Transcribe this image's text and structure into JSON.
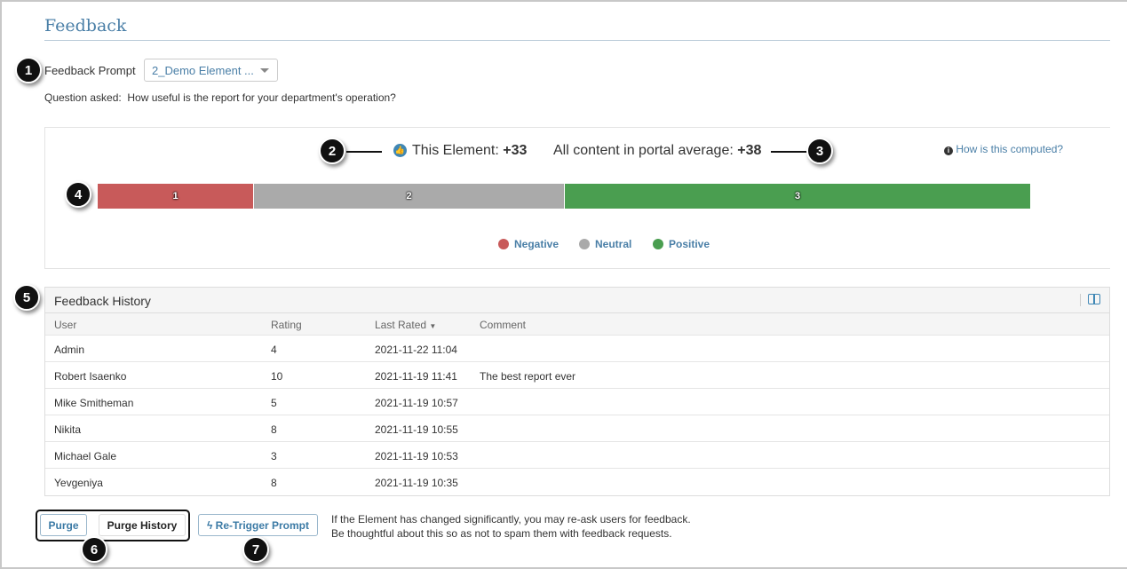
{
  "page": {
    "title": "Feedback"
  },
  "prompt": {
    "label": "Feedback Prompt",
    "selected": "2_Demo Element ...",
    "question_label": "Question asked:",
    "question": "How useful is the report for your department's operation?"
  },
  "summary": {
    "this_label": "This Element:",
    "this_value": "+33",
    "avg_label": "All content in portal average:",
    "avg_value": "+38",
    "help_link": "How is this computed?"
  },
  "chart_data": {
    "type": "bar",
    "stacked": true,
    "categories": [
      "Negative",
      "Neutral",
      "Positive"
    ],
    "values": [
      1,
      2,
      3
    ],
    "colors": [
      "#c85a5a",
      "#aaaaaa",
      "#4a9e50"
    ],
    "legend": [
      "Negative",
      "Neutral",
      "Positive"
    ],
    "legend_placement": "bottom"
  },
  "history": {
    "title": "Feedback History",
    "columns": [
      "User",
      "Rating",
      "Last Rated",
      "Comment"
    ],
    "rows": [
      {
        "user": "Admin",
        "rating": "4",
        "date": "2021-11-22 11:04",
        "comment": ""
      },
      {
        "user": "Robert Isaenko",
        "rating": "10",
        "date": "2021-11-19 11:41",
        "comment": "The best report ever"
      },
      {
        "user": "Mike Smitheman",
        "rating": "5",
        "date": "2021-11-19 10:57",
        "comment": ""
      },
      {
        "user": "Nikita",
        "rating": "8",
        "date": "2021-11-19 10:55",
        "comment": ""
      },
      {
        "user": "Michael Gale",
        "rating": "3",
        "date": "2021-11-19 10:53",
        "comment": ""
      },
      {
        "user": "Yevgeniya",
        "rating": "8",
        "date": "2021-11-19 10:35",
        "comment": ""
      }
    ]
  },
  "actions": {
    "purge": "Purge",
    "purge_history": "Purge History",
    "retrigger": "Re-Trigger Prompt",
    "note1": "If the Element has changed significantly, you may re-ask users for feedback.",
    "note2": "Be thoughtful about this so as not to spam them with feedback requests."
  },
  "callouts": [
    "1",
    "2",
    "3",
    "4",
    "5",
    "6",
    "7"
  ]
}
